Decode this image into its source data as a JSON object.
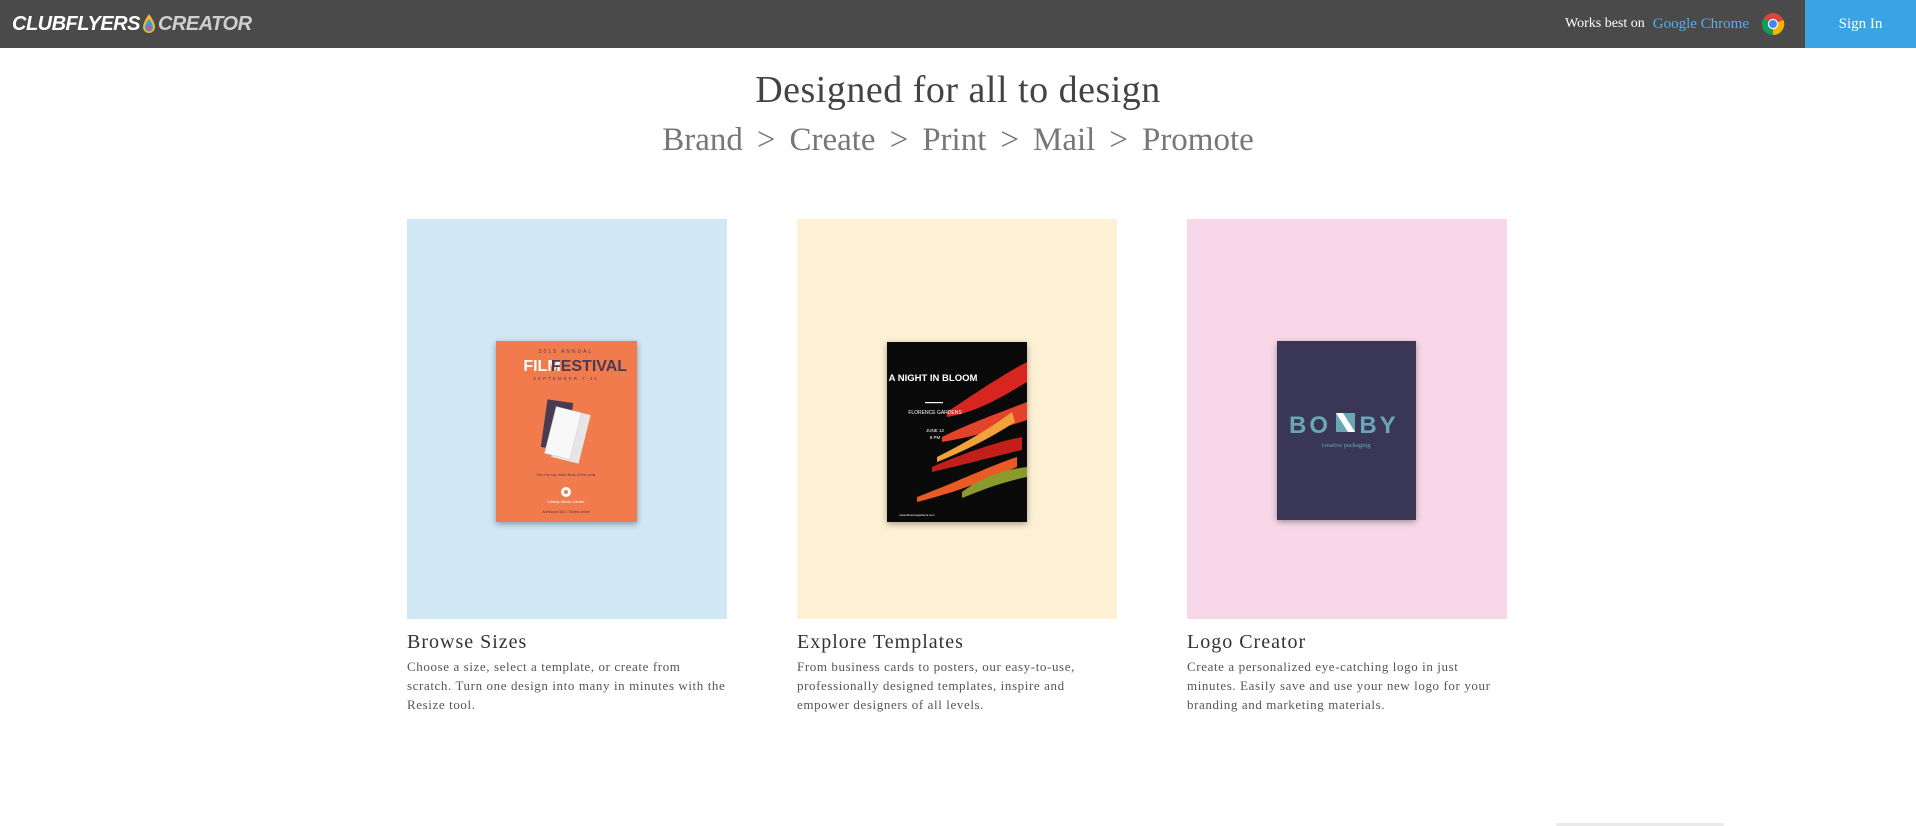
{
  "header": {
    "logo_primary": "CLUBFLYERS",
    "logo_secondary": "CREATOR",
    "works_best_text": "Works best on",
    "browser_link": "Google Chrome",
    "signin_label": "Sign In",
    "colors": {
      "bar": "#4a4a4a",
      "signin": "#3aa3e3",
      "link": "#4ab3f4"
    }
  },
  "hero": {
    "title": "Designed for all to design",
    "steps": [
      "Brand",
      "Create",
      "Print",
      "Mail",
      "Promote"
    ],
    "separator": ">"
  },
  "cards": [
    {
      "title": "Browse Sizes",
      "description": "Choose a size, select a template, or create from scratch. Turn one design into many in minutes with the Resize tool.",
      "panel_color": "#d0e8f4",
      "thumb": {
        "kicker": "2019 ANNUAL",
        "headline_a": "FILM",
        "headline_b": "FESTIVAL",
        "date": "SEPTEMBER 7-11",
        "tagline": "See the top indie films of the year",
        "venue": "Liberty Movie Center",
        "fine_print": "Admission $10 • Tickets online"
      }
    },
    {
      "title": "Explore Templates",
      "description": "From business cards to posters, our easy-to-use, professionally designed templates, inspire and empower designers of all levels.",
      "panel_color": "#fef0d4",
      "thumb": {
        "headline": "A NIGHT IN BLOOM",
        "venue": "FLORENCE GARDENS",
        "date": "JUNE 12",
        "time": "8 PM",
        "url": "www.florencegardens.com"
      }
    },
    {
      "title": "Logo Creator",
      "description": "Create a personalized eye-catching logo in just minutes. Easily save and use your new logo for your branding and marketing materials.",
      "panel_color": "#f8d8e8",
      "thumb": {
        "brand_a": "BO",
        "brand_b": "BY",
        "tagline": "creative packaging"
      }
    }
  ]
}
